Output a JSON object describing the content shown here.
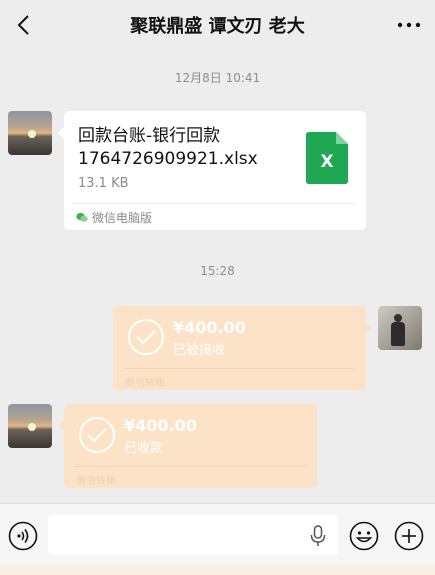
{
  "header": {
    "title": "聚联鼎盛 谭文刃 老大"
  },
  "timestamps": {
    "first": "12月8日 10:41",
    "second": "15:28"
  },
  "file_message": {
    "name_line1": "回款台账-银行回款",
    "name_line2": "1764726909921.xlsx",
    "size": "13.1 KB",
    "source": "微信电脑版",
    "icon_letter": "X",
    "icon_color": "#1fa753"
  },
  "transfers": [
    {
      "amount": "¥400.00",
      "status": "已被接收",
      "footer": "微信转账",
      "direction": "outgoing"
    },
    {
      "amount": "¥400.00",
      "status": "已收款",
      "footer": "微信转账",
      "direction": "incoming"
    }
  ],
  "input": {
    "placeholder": ""
  },
  "colors": {
    "background": "#ededed",
    "transfer_bubble": "#fce3c7",
    "excel_green": "#1fa753"
  }
}
